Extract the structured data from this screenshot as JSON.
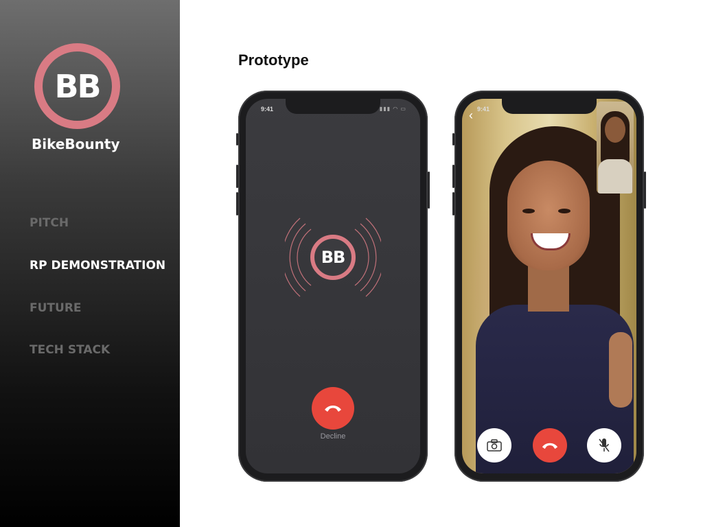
{
  "sidebar": {
    "logo_text": "BB",
    "brand_name": "BikeBounty",
    "nav": [
      {
        "label": "PITCH",
        "active": false
      },
      {
        "label": "RP DEMONSTRATION",
        "active": true
      },
      {
        "label": "FUTURE",
        "active": false
      },
      {
        "label": "TECH STACK",
        "active": false
      }
    ]
  },
  "main": {
    "title": "Prototype",
    "incoming_call": {
      "status_time": "9:41",
      "caller_logo": "BB",
      "decline_label": "Decline"
    },
    "video_call": {
      "status_time": "9:41",
      "controls": [
        "camera-flip-icon",
        "hang-up-icon",
        "mute-mic-icon"
      ]
    }
  },
  "colors": {
    "accent_pink": "#d97b84",
    "decline_red": "#e8473c",
    "sidebar_top": "#6e6e6e",
    "sidebar_bottom": "#000000"
  }
}
